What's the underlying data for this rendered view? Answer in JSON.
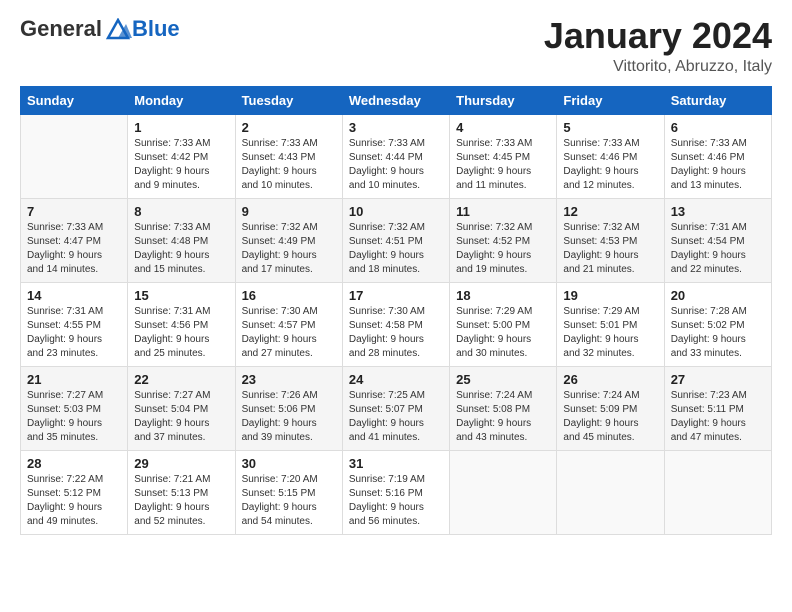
{
  "header": {
    "logo_general": "General",
    "logo_blue": "Blue",
    "month_title": "January 2024",
    "location": "Vittorito, Abruzzo, Italy"
  },
  "days_of_week": [
    "Sunday",
    "Monday",
    "Tuesday",
    "Wednesday",
    "Thursday",
    "Friday",
    "Saturday"
  ],
  "weeks": [
    [
      {
        "num": "",
        "sunrise": "",
        "sunset": "",
        "daylight": "",
        "empty": true
      },
      {
        "num": "1",
        "sunrise": "Sunrise: 7:33 AM",
        "sunset": "Sunset: 4:42 PM",
        "daylight": "Daylight: 9 hours and 9 minutes."
      },
      {
        "num": "2",
        "sunrise": "Sunrise: 7:33 AM",
        "sunset": "Sunset: 4:43 PM",
        "daylight": "Daylight: 9 hours and 10 minutes."
      },
      {
        "num": "3",
        "sunrise": "Sunrise: 7:33 AM",
        "sunset": "Sunset: 4:44 PM",
        "daylight": "Daylight: 9 hours and 10 minutes."
      },
      {
        "num": "4",
        "sunrise": "Sunrise: 7:33 AM",
        "sunset": "Sunset: 4:45 PM",
        "daylight": "Daylight: 9 hours and 11 minutes."
      },
      {
        "num": "5",
        "sunrise": "Sunrise: 7:33 AM",
        "sunset": "Sunset: 4:46 PM",
        "daylight": "Daylight: 9 hours and 12 minutes."
      },
      {
        "num": "6",
        "sunrise": "Sunrise: 7:33 AM",
        "sunset": "Sunset: 4:46 PM",
        "daylight": "Daylight: 9 hours and 13 minutes."
      }
    ],
    [
      {
        "num": "7",
        "sunrise": "Sunrise: 7:33 AM",
        "sunset": "Sunset: 4:47 PM",
        "daylight": "Daylight: 9 hours and 14 minutes."
      },
      {
        "num": "8",
        "sunrise": "Sunrise: 7:33 AM",
        "sunset": "Sunset: 4:48 PM",
        "daylight": "Daylight: 9 hours and 15 minutes."
      },
      {
        "num": "9",
        "sunrise": "Sunrise: 7:32 AM",
        "sunset": "Sunset: 4:49 PM",
        "daylight": "Daylight: 9 hours and 17 minutes."
      },
      {
        "num": "10",
        "sunrise": "Sunrise: 7:32 AM",
        "sunset": "Sunset: 4:51 PM",
        "daylight": "Daylight: 9 hours and 18 minutes."
      },
      {
        "num": "11",
        "sunrise": "Sunrise: 7:32 AM",
        "sunset": "Sunset: 4:52 PM",
        "daylight": "Daylight: 9 hours and 19 minutes."
      },
      {
        "num": "12",
        "sunrise": "Sunrise: 7:32 AM",
        "sunset": "Sunset: 4:53 PM",
        "daylight": "Daylight: 9 hours and 21 minutes."
      },
      {
        "num": "13",
        "sunrise": "Sunrise: 7:31 AM",
        "sunset": "Sunset: 4:54 PM",
        "daylight": "Daylight: 9 hours and 22 minutes."
      }
    ],
    [
      {
        "num": "14",
        "sunrise": "Sunrise: 7:31 AM",
        "sunset": "Sunset: 4:55 PM",
        "daylight": "Daylight: 9 hours and 23 minutes."
      },
      {
        "num": "15",
        "sunrise": "Sunrise: 7:31 AM",
        "sunset": "Sunset: 4:56 PM",
        "daylight": "Daylight: 9 hours and 25 minutes."
      },
      {
        "num": "16",
        "sunrise": "Sunrise: 7:30 AM",
        "sunset": "Sunset: 4:57 PM",
        "daylight": "Daylight: 9 hours and 27 minutes."
      },
      {
        "num": "17",
        "sunrise": "Sunrise: 7:30 AM",
        "sunset": "Sunset: 4:58 PM",
        "daylight": "Daylight: 9 hours and 28 minutes."
      },
      {
        "num": "18",
        "sunrise": "Sunrise: 7:29 AM",
        "sunset": "Sunset: 5:00 PM",
        "daylight": "Daylight: 9 hours and 30 minutes."
      },
      {
        "num": "19",
        "sunrise": "Sunrise: 7:29 AM",
        "sunset": "Sunset: 5:01 PM",
        "daylight": "Daylight: 9 hours and 32 minutes."
      },
      {
        "num": "20",
        "sunrise": "Sunrise: 7:28 AM",
        "sunset": "Sunset: 5:02 PM",
        "daylight": "Daylight: 9 hours and 33 minutes."
      }
    ],
    [
      {
        "num": "21",
        "sunrise": "Sunrise: 7:27 AM",
        "sunset": "Sunset: 5:03 PM",
        "daylight": "Daylight: 9 hours and 35 minutes."
      },
      {
        "num": "22",
        "sunrise": "Sunrise: 7:27 AM",
        "sunset": "Sunset: 5:04 PM",
        "daylight": "Daylight: 9 hours and 37 minutes."
      },
      {
        "num": "23",
        "sunrise": "Sunrise: 7:26 AM",
        "sunset": "Sunset: 5:06 PM",
        "daylight": "Daylight: 9 hours and 39 minutes."
      },
      {
        "num": "24",
        "sunrise": "Sunrise: 7:25 AM",
        "sunset": "Sunset: 5:07 PM",
        "daylight": "Daylight: 9 hours and 41 minutes."
      },
      {
        "num": "25",
        "sunrise": "Sunrise: 7:24 AM",
        "sunset": "Sunset: 5:08 PM",
        "daylight": "Daylight: 9 hours and 43 minutes."
      },
      {
        "num": "26",
        "sunrise": "Sunrise: 7:24 AM",
        "sunset": "Sunset: 5:09 PM",
        "daylight": "Daylight: 9 hours and 45 minutes."
      },
      {
        "num": "27",
        "sunrise": "Sunrise: 7:23 AM",
        "sunset": "Sunset: 5:11 PM",
        "daylight": "Daylight: 9 hours and 47 minutes."
      }
    ],
    [
      {
        "num": "28",
        "sunrise": "Sunrise: 7:22 AM",
        "sunset": "Sunset: 5:12 PM",
        "daylight": "Daylight: 9 hours and 49 minutes."
      },
      {
        "num": "29",
        "sunrise": "Sunrise: 7:21 AM",
        "sunset": "Sunset: 5:13 PM",
        "daylight": "Daylight: 9 hours and 52 minutes."
      },
      {
        "num": "30",
        "sunrise": "Sunrise: 7:20 AM",
        "sunset": "Sunset: 5:15 PM",
        "daylight": "Daylight: 9 hours and 54 minutes."
      },
      {
        "num": "31",
        "sunrise": "Sunrise: 7:19 AM",
        "sunset": "Sunset: 5:16 PM",
        "daylight": "Daylight: 9 hours and 56 minutes."
      },
      {
        "num": "",
        "sunrise": "",
        "sunset": "",
        "daylight": "",
        "empty": true
      },
      {
        "num": "",
        "sunrise": "",
        "sunset": "",
        "daylight": "",
        "empty": true
      },
      {
        "num": "",
        "sunrise": "",
        "sunset": "",
        "daylight": "",
        "empty": true
      }
    ]
  ]
}
